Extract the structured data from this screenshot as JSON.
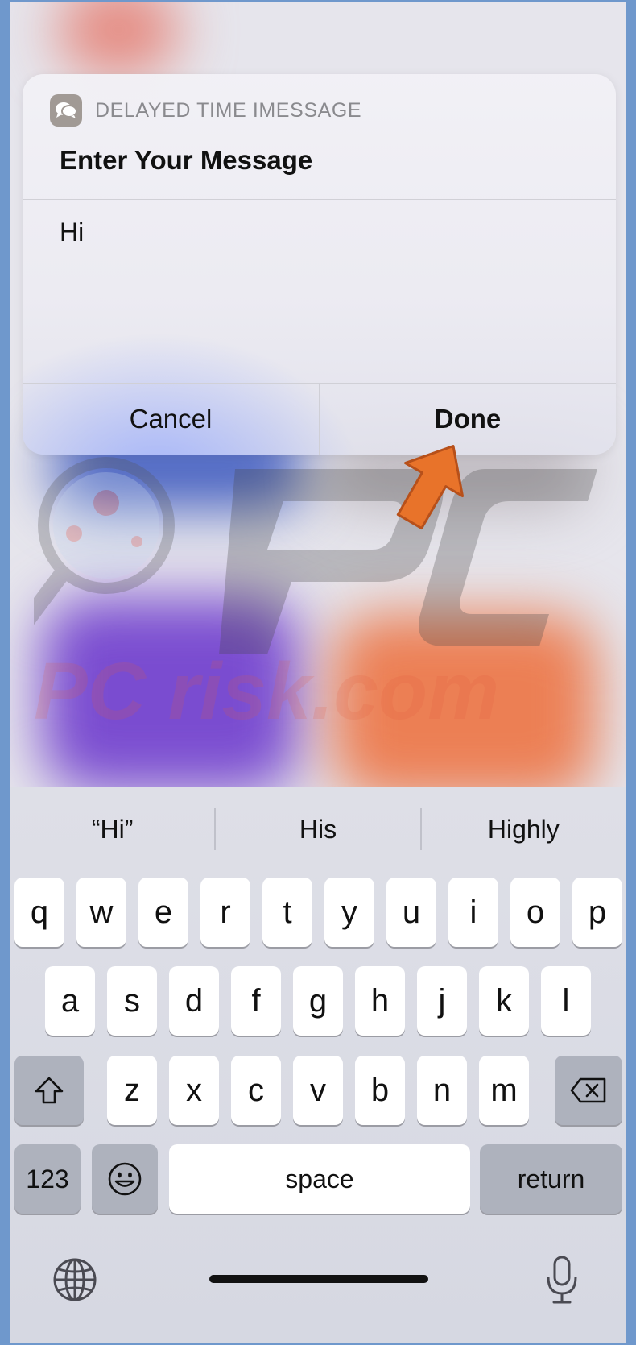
{
  "dialog": {
    "app_name": "DELAYED TIME IMESSAGE",
    "title": "Enter Your Message",
    "message_value": "Hi",
    "cancel_label": "Cancel",
    "done_label": "Done"
  },
  "watermark": {
    "text": "PC risk.com"
  },
  "keyboard": {
    "suggestions": [
      "“Hi”",
      "His",
      "Highly"
    ],
    "row1": [
      "q",
      "w",
      "e",
      "r",
      "t",
      "y",
      "u",
      "i",
      "o",
      "p"
    ],
    "row2": [
      "a",
      "s",
      "d",
      "f",
      "g",
      "h",
      "j",
      "k",
      "l"
    ],
    "row3": [
      "z",
      "x",
      "c",
      "v",
      "b",
      "n",
      "m"
    ],
    "numbers_label": "123",
    "space_label": "space",
    "return_label": "return"
  },
  "colors": {
    "arrow": "#e8732a",
    "key_bg": "#ffffff",
    "special_key_bg": "#aeb2bd"
  },
  "icons": [
    "messages-icon",
    "shift-icon",
    "delete-icon",
    "emoji-icon",
    "globe-icon",
    "microphone-icon",
    "arrow-annotation-icon"
  ]
}
